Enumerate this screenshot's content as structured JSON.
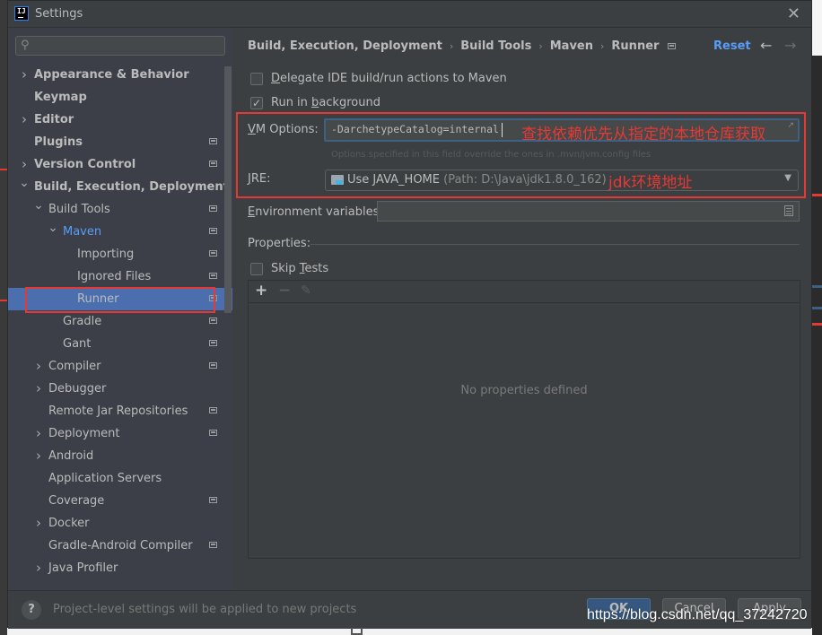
{
  "window": {
    "title": "Settings",
    "app_icon": "intellij-icon",
    "close_icon": "close-icon"
  },
  "search": {
    "placeholder": "",
    "value": ""
  },
  "sidebar": {
    "items": [
      {
        "label": "Appearance & Behavior",
        "level": 0,
        "bold": true,
        "chevron": "right",
        "project_icon": false
      },
      {
        "label": "Keymap",
        "level": 0,
        "bold": true,
        "chevron": "",
        "project_icon": false
      },
      {
        "label": "Editor",
        "level": 0,
        "bold": true,
        "chevron": "right",
        "project_icon": false
      },
      {
        "label": "Plugins",
        "level": 0,
        "bold": true,
        "chevron": "",
        "project_icon": true
      },
      {
        "label": "Version Control",
        "level": 0,
        "bold": true,
        "chevron": "right",
        "project_icon": true
      },
      {
        "label": "Build, Execution, Deployment",
        "level": 0,
        "bold": true,
        "chevron": "down",
        "project_icon": false
      },
      {
        "label": "Build Tools",
        "level": 1,
        "bold": false,
        "chevron": "down",
        "project_icon": true
      },
      {
        "label": "Maven",
        "level": 2,
        "bold": false,
        "chevron": "down",
        "project_icon": true,
        "link": true
      },
      {
        "label": "Importing",
        "level": 3,
        "bold": false,
        "chevron": "",
        "project_icon": true
      },
      {
        "label": "Ignored Files",
        "level": 3,
        "bold": false,
        "chevron": "",
        "project_icon": true
      },
      {
        "label": "Runner",
        "level": 3,
        "bold": false,
        "chevron": "",
        "project_icon": true,
        "selected": true
      },
      {
        "label": "Gradle",
        "level": 2,
        "bold": false,
        "chevron": "",
        "project_icon": true
      },
      {
        "label": "Gant",
        "level": 2,
        "bold": false,
        "chevron": "",
        "project_icon": true
      },
      {
        "label": "Compiler",
        "level": 1,
        "bold": false,
        "chevron": "right",
        "project_icon": true
      },
      {
        "label": "Debugger",
        "level": 1,
        "bold": false,
        "chevron": "right",
        "project_icon": false
      },
      {
        "label": "Remote Jar Repositories",
        "level": 1,
        "bold": false,
        "chevron": "",
        "project_icon": true
      },
      {
        "label": "Deployment",
        "level": 1,
        "bold": false,
        "chevron": "right",
        "project_icon": true
      },
      {
        "label": "Android",
        "level": 1,
        "bold": false,
        "chevron": "right",
        "project_icon": false
      },
      {
        "label": "Application Servers",
        "level": 1,
        "bold": false,
        "chevron": "",
        "project_icon": false
      },
      {
        "label": "Coverage",
        "level": 1,
        "bold": false,
        "chevron": "",
        "project_icon": true
      },
      {
        "label": "Docker",
        "level": 1,
        "bold": false,
        "chevron": "right",
        "project_icon": false
      },
      {
        "label": "Gradle-Android Compiler",
        "level": 1,
        "bold": false,
        "chevron": "",
        "project_icon": true
      },
      {
        "label": "Java Profiler",
        "level": 1,
        "bold": false,
        "chevron": "right",
        "project_icon": false
      }
    ]
  },
  "header": {
    "breadcrumb": [
      "Build, Execution, Deployment",
      "Build Tools",
      "Maven",
      "Runner"
    ],
    "reset_label": "Reset",
    "back_icon": "←",
    "forward_icon": "→"
  },
  "options": {
    "delegate": {
      "label_u": "D",
      "label_rest": "elegate IDE build/run actions to Maven",
      "checked": false
    },
    "background": {
      "label_pre": "Run in ",
      "label_u": "b",
      "label_rest": "ackground",
      "checked": true
    }
  },
  "vm": {
    "label_u": "V",
    "label_rest": "M Options:",
    "value": "-DarchetypeCatalog=internal",
    "hint": "Options specified in this field override the ones in .mvn/jvm.config files"
  },
  "jre": {
    "label_u": "J",
    "label_rest": "RE:",
    "value": "Use JAVA_HOME",
    "path": "(Path: D:\\Java\\jdk1.8.0_162)"
  },
  "env": {
    "label_u": "E",
    "label_rest": "nvironment variables:",
    "value": ""
  },
  "properties": {
    "label": "Properties:",
    "skip_tests": {
      "label_pre": "Skip ",
      "label_u": "T",
      "label_rest": "ests",
      "checked": false
    },
    "toolbar": {
      "add": "+",
      "remove": "−",
      "edit": "✎"
    },
    "empty_text": "No properties defined"
  },
  "annotations": {
    "vm_note": "查找依赖优先从指定的本地仓库获取",
    "jre_note": "jdk环境地址",
    "color": "#e53935"
  },
  "footer": {
    "help": "?",
    "text": "Project-level settings will be applied to new projects",
    "ok": "OK",
    "cancel": "Cancel",
    "apply": "Apply"
  },
  "watermark": "https://blog.csdn.net/qq_37242720",
  "colors": {
    "accent": "#589df6",
    "selection": "#4b6eaf",
    "ok_button": "#365880",
    "dialog_bg": "#3c3f41",
    "sidebar_bg": "#3c3f47"
  }
}
